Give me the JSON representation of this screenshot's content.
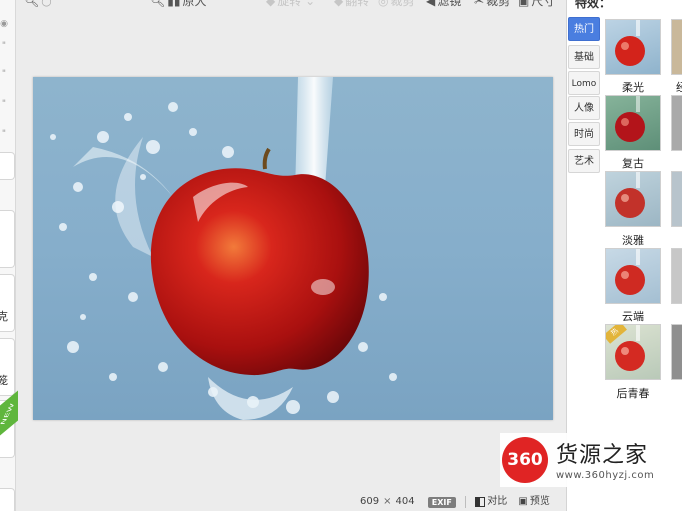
{
  "toolbar": {
    "items": [
      {
        "icon": "magnifier-icon",
        "label": ""
      },
      {
        "icon": "magnifier-icon",
        "label": "原大"
      },
      {
        "icon": "rotate-icon",
        "label": "旋转"
      },
      {
        "icon": "flip-icon",
        "label": "翻转"
      },
      {
        "icon": "crop-icon",
        "label": "裁剪"
      },
      {
        "icon": "filter-icon",
        "label": "滤镜"
      },
      {
        "icon": "scissors-icon",
        "label": "裁剪"
      },
      {
        "icon": "resize-icon",
        "label": "尺寸"
      }
    ]
  },
  "left_panel": {
    "cap_texts": [
      "克",
      "笼"
    ],
    "new_ribbon": "NEW"
  },
  "effects_panel": {
    "title": "特效：",
    "categories": [
      {
        "label": "热门",
        "active": true
      },
      {
        "label": "基础",
        "active": false
      },
      {
        "label": "Lomo",
        "active": false
      },
      {
        "label": "人像",
        "active": false
      },
      {
        "label": "时尚",
        "active": false
      },
      {
        "label": "艺术",
        "active": false
      }
    ],
    "effects": [
      {
        "label": "柔光",
        "peek": "经"
      },
      {
        "label": "复古",
        "peek": ""
      },
      {
        "label": "淡雅",
        "peek": ""
      },
      {
        "label": "云端",
        "peek": ""
      },
      {
        "label": "后青春",
        "peek": "",
        "badge": "热"
      }
    ]
  },
  "status_bar": {
    "width": "609",
    "times": "×",
    "height": "404",
    "exif": "EXIF",
    "compare": "对比",
    "preview": "预览"
  },
  "watermark": {
    "logo": "360",
    "title": "货源之家",
    "url": "www.360hyzj.com"
  }
}
